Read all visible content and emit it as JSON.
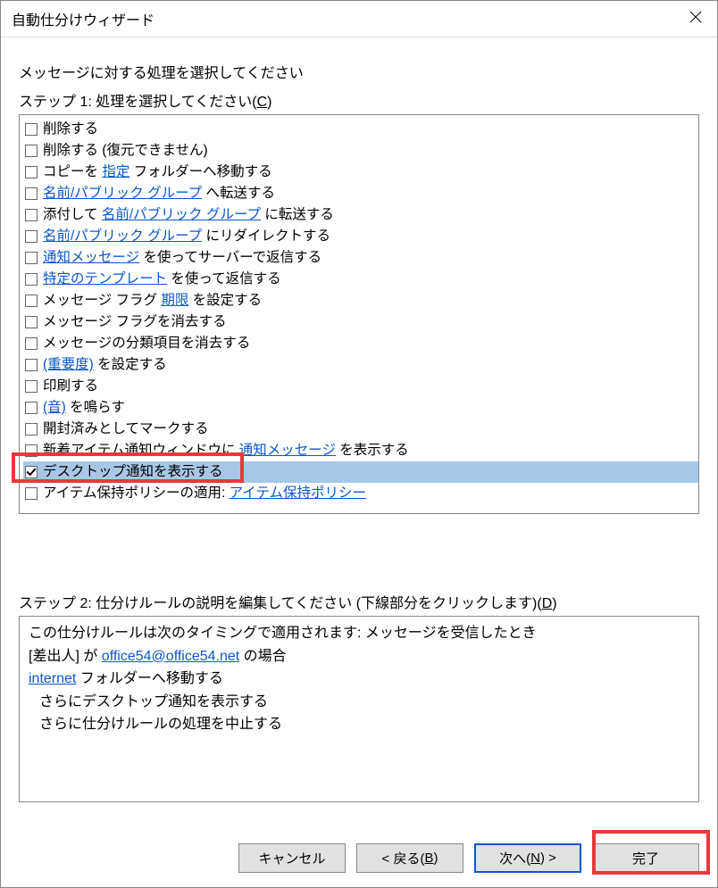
{
  "title": "自動仕分けウィザード",
  "instruction": "メッセージに対する処理を選択してください",
  "step1": {
    "prefix": "ステップ 1: 処理を選択してください(",
    "accel": "C",
    "suffix": ")"
  },
  "actions": [
    {
      "checked": false,
      "selected": false,
      "parts": [
        {
          "t": "削除する"
        }
      ]
    },
    {
      "checked": false,
      "selected": false,
      "parts": [
        {
          "t": "削除する (復元できません)"
        }
      ]
    },
    {
      "checked": false,
      "selected": false,
      "parts": [
        {
          "t": "コピーを "
        },
        {
          "t": "指定",
          "link": true
        },
        {
          "t": " フォルダーへ移動する"
        }
      ]
    },
    {
      "checked": false,
      "selected": false,
      "parts": [
        {
          "t": "名前/パブリック グループ",
          "link": true
        },
        {
          "t": " へ転送する"
        }
      ]
    },
    {
      "checked": false,
      "selected": false,
      "parts": [
        {
          "t": "添付して "
        },
        {
          "t": "名前/パブリック グループ",
          "link": true
        },
        {
          "t": " に転送する"
        }
      ]
    },
    {
      "checked": false,
      "selected": false,
      "parts": [
        {
          "t": "名前/パブリック グループ",
          "link": true
        },
        {
          "t": " にリダイレクトする"
        }
      ]
    },
    {
      "checked": false,
      "selected": false,
      "parts": [
        {
          "t": "通知メッセージ",
          "link": true
        },
        {
          "t": " を使ってサーバーで返信する"
        }
      ]
    },
    {
      "checked": false,
      "selected": false,
      "parts": [
        {
          "t": "特定のテンプレート",
          "link": true
        },
        {
          "t": " を使って返信する"
        }
      ]
    },
    {
      "checked": false,
      "selected": false,
      "parts": [
        {
          "t": "メッセージ フラグ "
        },
        {
          "t": "期限",
          "link": true
        },
        {
          "t": " を設定する"
        }
      ]
    },
    {
      "checked": false,
      "selected": false,
      "parts": [
        {
          "t": "メッセージ フラグを消去する"
        }
      ]
    },
    {
      "checked": false,
      "selected": false,
      "parts": [
        {
          "t": "メッセージの分類項目を消去する"
        }
      ]
    },
    {
      "checked": false,
      "selected": false,
      "parts": [
        {
          "t": "(重要度)",
          "link": true
        },
        {
          "t": " を設定する"
        }
      ]
    },
    {
      "checked": false,
      "selected": false,
      "parts": [
        {
          "t": "印刷する"
        }
      ]
    },
    {
      "checked": false,
      "selected": false,
      "parts": [
        {
          "t": "(音)",
          "link": true
        },
        {
          "t": " を鳴らす"
        }
      ]
    },
    {
      "checked": false,
      "selected": false,
      "parts": [
        {
          "t": "開封済みとしてマークする"
        }
      ]
    },
    {
      "checked": false,
      "selected": false,
      "parts": [
        {
          "t": "新着アイテム通知ウィンドウに "
        },
        {
          "t": "通知メッセージ",
          "link": true
        },
        {
          "t": " を表示する"
        }
      ]
    },
    {
      "checked": true,
      "selected": true,
      "parts": [
        {
          "t": "デスクトップ通知を表示する"
        }
      ]
    },
    {
      "checked": false,
      "selected": false,
      "parts": [
        {
          "t": "アイテム保持ポリシーの適用: "
        },
        {
          "t": "アイテム保持ポリシー",
          "link": true
        }
      ]
    }
  ],
  "step2": {
    "prefix": "ステップ 2: 仕分けルールの説明を編集してください (下線部分をクリックします)(",
    "accel": "D",
    "suffix": ")"
  },
  "desc": {
    "line1": "この仕分けルールは次のタイミングで適用されます: メッセージを受信したとき",
    "line2_a": "[差出人] が ",
    "line2_link": "office54@office54.net",
    "line2_b": " の場合",
    "line3_link": "internet",
    "line3_b": " フォルダーへ移動する",
    "line4": "さらにデスクトップ通知を表示する",
    "line5": "さらに仕分けルールの処理を中止する"
  },
  "buttons": {
    "cancel": "キャンセル",
    "back_pre": "< 戻る(",
    "back_accel": "B",
    "back_post": ")",
    "next_pre": "次へ(",
    "next_accel": "N",
    "next_post": ") >",
    "finish": "完了"
  }
}
